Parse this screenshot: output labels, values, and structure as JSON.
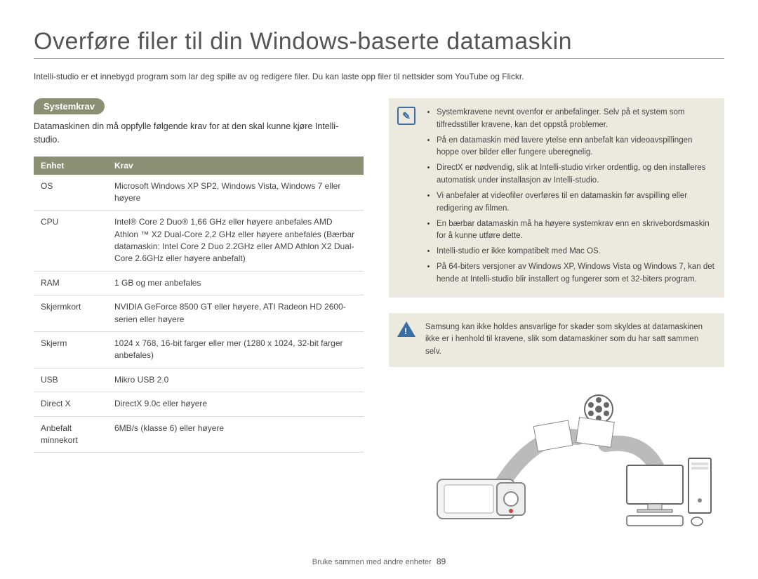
{
  "title": "Overføre filer til din Windows-baserte datamaskin",
  "intro": "Intelli-studio er et innebygd program som lar deg spille av og redigere filer. Du kan laste opp filer til nettsider som YouTube og Flickr.",
  "section_badge": "Systemkrav",
  "lead": "Datamaskinen din må oppfylle følgende krav for at den skal kunne kjøre Intelli-studio.",
  "table": {
    "headers": {
      "unit": "Enhet",
      "req": "Krav"
    },
    "rows": [
      {
        "unit": "OS",
        "req": "Microsoft Windows XP SP2, Windows Vista, Windows 7 eller høyere"
      },
      {
        "unit": "CPU",
        "req": "Intel® Core 2 Duo® 1,66 GHz eller høyere anbefales AMD Athlon ™ X2 Dual-Core 2,2 GHz eller høyere anbefales (Bærbar datamaskin: Intel Core 2 Duo 2.2GHz eller AMD Athlon X2 Dual-Core 2.6GHz eller høyere anbefalt)"
      },
      {
        "unit": "RAM",
        "req": "1 GB og mer anbefales"
      },
      {
        "unit": "Skjermkort",
        "req": "NVIDIA GeForce 8500 GT eller høyere, ATI Radeon HD 2600-serien eller høyere"
      },
      {
        "unit": "Skjerm",
        "req": "1024 x 768, 16-bit farger eller mer (1280 x 1024, 32-bit farger anbefales)"
      },
      {
        "unit": "USB",
        "req": "Mikro USB 2.0"
      },
      {
        "unit": "Direct X",
        "req": "DirectX 9.0c eller høyere"
      },
      {
        "unit": "Anbefalt minnekort",
        "req": "6MB/s (klasse 6) eller høyere"
      }
    ]
  },
  "notes": [
    "Systemkravene nevnt ovenfor er anbefalinger. Selv på et system som tilfredsstiller kravene, kan det oppstå problemer.",
    "På en datamaskin med lavere ytelse enn anbefalt kan videoavspillingen hoppe over bilder eller fungere uberegnelig.",
    "DirectX er nødvendig, slik at Intelli-studio virker ordentlig, og den installeres automatisk under installasjon av Intelli-studio.",
    "Vi anbefaler at videofiler overføres til en datamaskin før avspilling eller redigering av filmen.",
    "En bærbar datamaskin må ha høyere systemkrav enn en skrivebordsmaskin for å kunne utføre dette.",
    "Intelli-studio er ikke kompatibelt med Mac OS.",
    "På 64-biters versjoner av Windows XP, Windows Vista og Windows 7, kan det hende at Intelli-studio blir installert og fungerer som et 32-biters program."
  ],
  "warning": "Samsung kan ikke holdes ansvarlige for skader som skyldes at datamaskinen ikke er i henhold til kravene, slik som datamaskiner som du har satt sammen selv.",
  "footer": {
    "text": "Bruke sammen med andre enheter",
    "page": "89"
  }
}
